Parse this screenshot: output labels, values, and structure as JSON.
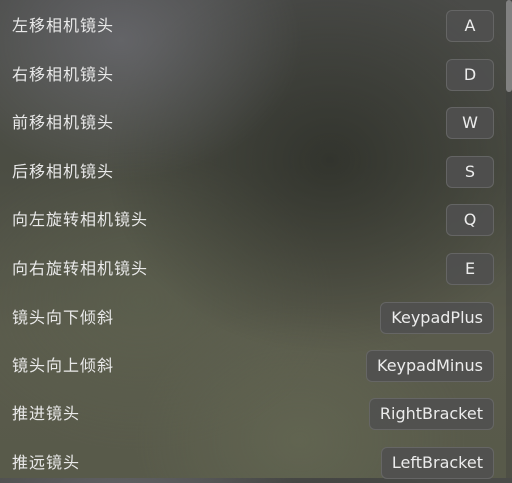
{
  "keybindings": [
    {
      "action": "左移相机镜头",
      "key": "A"
    },
    {
      "action": "右移相机镜头",
      "key": "D"
    },
    {
      "action": "前移相机镜头",
      "key": "W"
    },
    {
      "action": "后移相机镜头",
      "key": "S"
    },
    {
      "action": "向左旋转相机镜头",
      "key": "Q"
    },
    {
      "action": "向右旋转相机镜头",
      "key": "E"
    },
    {
      "action": "镜头向下倾斜",
      "key": "KeypadPlus"
    },
    {
      "action": "镜头向上倾斜",
      "key": "KeypadMinus"
    },
    {
      "action": "推进镜头",
      "key": "RightBracket"
    },
    {
      "action": "推远镜头",
      "key": "LeftBracket"
    }
  ]
}
